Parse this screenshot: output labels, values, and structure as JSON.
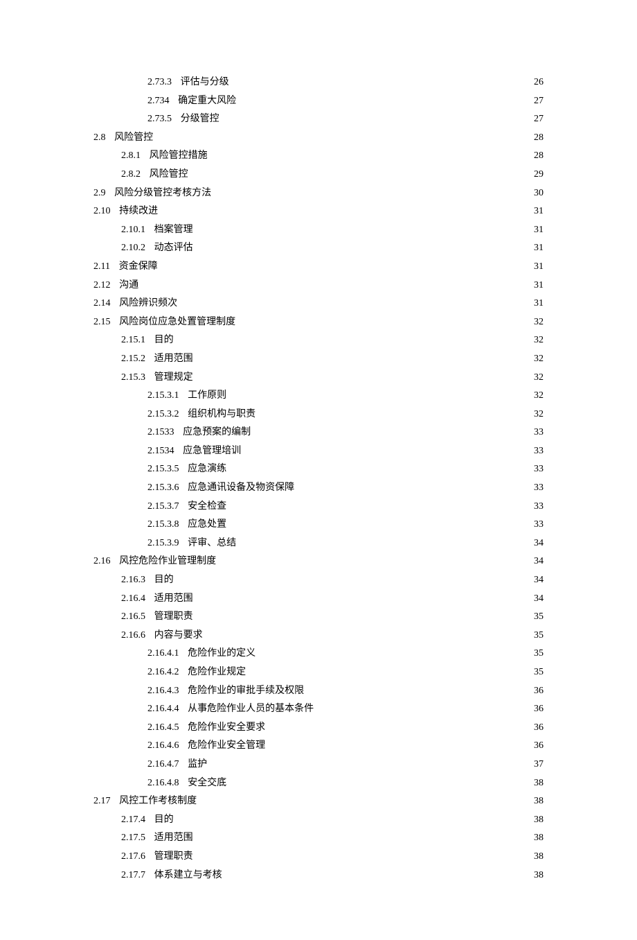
{
  "toc": [
    {
      "level": 3,
      "num": "2.73.3",
      "title": "评估与分级",
      "page": "26"
    },
    {
      "level": 3,
      "num": "2.734",
      "title": "确定重大风险",
      "page": "27"
    },
    {
      "level": 3,
      "num": "2.73.5",
      "title": "分级管控",
      "page": "27"
    },
    {
      "level": 1,
      "num": "2.8",
      "title": "风险管控",
      "page": "28"
    },
    {
      "level": 2,
      "num": "2.8.1",
      "title": "风险管控措施",
      "page": "28"
    },
    {
      "level": 2,
      "num": "2.8.2",
      "title": "风险管控",
      "page": "29"
    },
    {
      "level": 1,
      "num": "2.9",
      "title": "风险分级管控考核方法",
      "page": "30"
    },
    {
      "level": 1,
      "num": "2.10",
      "title": "持续改进",
      "page": "31"
    },
    {
      "level": 2,
      "num": "2.10.1",
      "title": "档案管理",
      "page": "31"
    },
    {
      "level": 2,
      "num": "2.10.2",
      "title": "动态评估",
      "page": "31"
    },
    {
      "level": 1,
      "num": "2.11",
      "title": "资金保障",
      "page": "31"
    },
    {
      "level": 1,
      "num": "2.12",
      "title": "沟通",
      "page": "31"
    },
    {
      "level": 1,
      "num": "2.14",
      "title": "风险辨识频次",
      "page": "31"
    },
    {
      "level": 1,
      "num": "2.15",
      "title": "风险岗位应急处置管理制度",
      "page": "32"
    },
    {
      "level": 2,
      "num": "2.15.1",
      "title": "目的",
      "page": "32"
    },
    {
      "level": 2,
      "num": "2.15.2",
      "title": "适用范围",
      "page": "32"
    },
    {
      "level": 2,
      "num": "2.15.3",
      "title": "管理规定",
      "page": "32"
    },
    {
      "level": 3,
      "num": "2.15.3.1",
      "title": "工作原则",
      "page": "32"
    },
    {
      "level": 3,
      "num": "2.15.3.2",
      "title": "组织机构与职责",
      "page": "32"
    },
    {
      "level": 3,
      "num": "2.1533",
      "title": "应急预案的编制",
      "page": "33"
    },
    {
      "level": 3,
      "num": "2.1534",
      "title": "应急管理培训",
      "page": "33"
    },
    {
      "level": 3,
      "num": "2.15.3.5",
      "title": "应急演练",
      "page": "33"
    },
    {
      "level": 3,
      "num": "2.15.3.6",
      "title": "应急通讯设备及物资保障",
      "page": "33"
    },
    {
      "level": 3,
      "num": "2.15.3.7",
      "title": "安全检查",
      "page": "33"
    },
    {
      "level": 3,
      "num": "2.15.3.8",
      "title": "应急处置",
      "page": "33"
    },
    {
      "level": 3,
      "num": "2.15.3.9",
      "title": "评审、总结",
      "page": "34"
    },
    {
      "level": 1,
      "num": "2.16",
      "title": "风控危险作业管理制度",
      "page": "34"
    },
    {
      "level": 2,
      "num": "2.16.3",
      "title": "目的",
      "page": "34"
    },
    {
      "level": 2,
      "num": "2.16.4",
      "title": "适用范围",
      "page": "34"
    },
    {
      "level": 2,
      "num": "2.16.5",
      "title": "管理职责",
      "page": "35"
    },
    {
      "level": 2,
      "num": "2.16.6",
      "title": "内容与要求",
      "page": "35"
    },
    {
      "level": 3,
      "num": "2.16.4.1",
      "title": "危险作业的定义",
      "page": "35"
    },
    {
      "level": 3,
      "num": "2.16.4.2",
      "title": "危险作业规定",
      "page": "35"
    },
    {
      "level": 3,
      "num": "2.16.4.3",
      "title": "危险作业的审批手续及权限",
      "page": "36"
    },
    {
      "level": 3,
      "num": "2.16.4.4",
      "title": "从事危险作业人员的基本条件",
      "page": "36"
    },
    {
      "level": 3,
      "num": "2.16.4.5",
      "title": "危险作业安全要求",
      "page": "36"
    },
    {
      "level": 3,
      "num": "2.16.4.6",
      "title": "危险作业安全管理",
      "page": "36"
    },
    {
      "level": 3,
      "num": "2.16.4.7",
      "title": "监护",
      "page": "37"
    },
    {
      "level": 3,
      "num": "2.16.4.8",
      "title": "安全交底",
      "page": "38"
    },
    {
      "level": 1,
      "num": "2.17",
      "title": "风控工作考核制度",
      "page": "38"
    },
    {
      "level": 2,
      "num": "2.17.4",
      "title": "目的",
      "page": "38"
    },
    {
      "level": 2,
      "num": "2.17.5",
      "title": "适用范围",
      "page": "38"
    },
    {
      "level": 2,
      "num": "2.17.6",
      "title": "管理职责",
      "page": "38"
    },
    {
      "level": 2,
      "num": "2.17.7",
      "title": "体系建立与考核",
      "page": "38"
    }
  ]
}
